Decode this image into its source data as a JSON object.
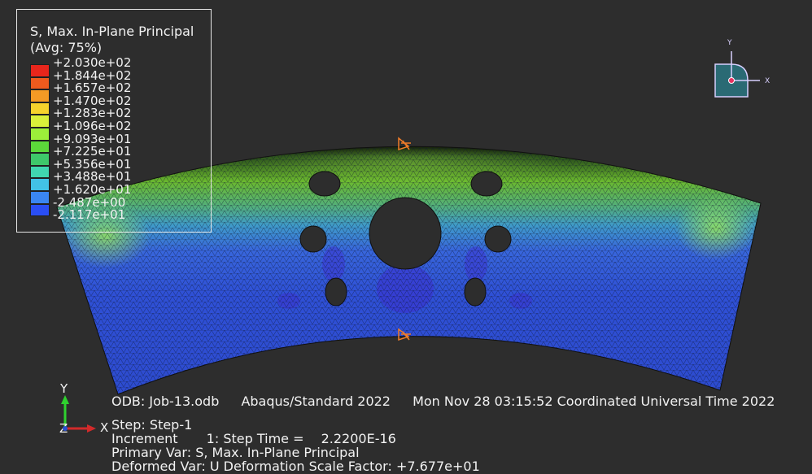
{
  "legend": {
    "title": "S, Max. In-Plane Principal",
    "subtitle": "(Avg: 75%)",
    "values": [
      "+2.030e+02",
      "+1.844e+02",
      "+1.657e+02",
      "+1.470e+02",
      "+1.283e+02",
      "+1.096e+02",
      "+9.093e+01",
      "+7.225e+01",
      "+5.356e+01",
      "+3.488e+01",
      "+1.620e+01",
      "-2.487e+00",
      "-2.117e+01"
    ],
    "colors": [
      "#e8261c",
      "#ee5a1e",
      "#f49a25",
      "#f6d22c",
      "#d9f03a",
      "#9cee3a",
      "#5cd83a",
      "#3ec86a",
      "#40d6b0",
      "#42c2e6",
      "#3a86f2",
      "#2a4ef4",
      "#1a1ae0"
    ]
  },
  "triad": {
    "y_label": "Y",
    "z_label": "Z",
    "x_label": "X"
  },
  "view_cube": {
    "y_label": "Y",
    "x_label": "X"
  },
  "info": {
    "odb": "ODB: Job-13.odb",
    "solver": "Abaqus/Standard 2022",
    "date": "Mon Nov 28 03:15:52 Coordinated Universal Time 2022",
    "step": "Step: Step-1",
    "increment_label": "Increment",
    "increment_value": "1: Step Time =",
    "step_time": "2.2200E-16",
    "primary_var": "Primary Var: S, Max. In-Plane Principal",
    "deformed_var": "Deformed Var: U   Deformation Scale Factor: +7.677e+01"
  }
}
